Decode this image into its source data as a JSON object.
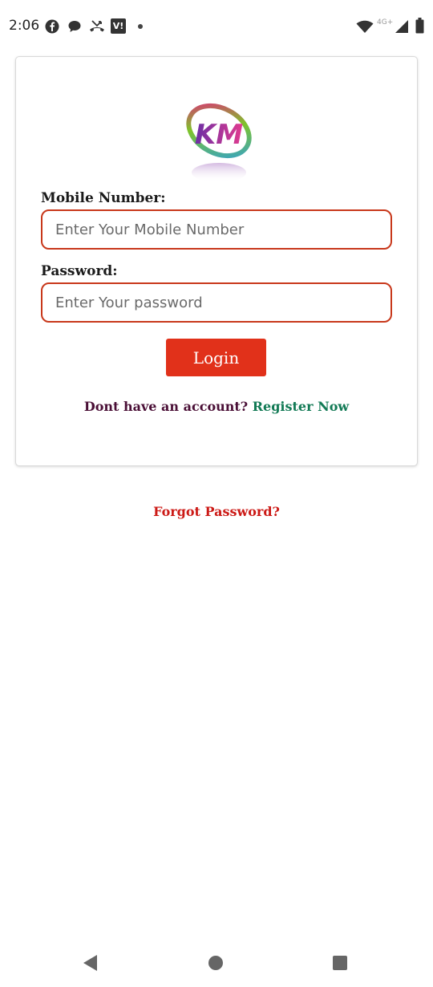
{
  "status_bar": {
    "time": "2:06",
    "network_label": "4G+",
    "left_icons": [
      "facebook-icon",
      "chat-icon",
      "missed-call-icon",
      "vi-app-icon",
      "dot-icon"
    ],
    "right_icons": [
      "wifi-icon",
      "signal-icon",
      "battery-icon"
    ]
  },
  "logo": {
    "text": "KM"
  },
  "form": {
    "mobile_label": "Mobile Number:",
    "mobile_placeholder": "Enter Your Mobile Number",
    "password_label": "Password:",
    "password_placeholder": "Enter Your password",
    "login_label": "Login"
  },
  "register": {
    "prompt": "Dont have an account?",
    "link": "Register Now"
  },
  "forgot_password": "Forgot Password?",
  "nav_bar": {
    "buttons": [
      "back-icon",
      "home-icon",
      "recents-icon"
    ]
  },
  "colors": {
    "accent": "#e1311a",
    "input_border": "#c8381b",
    "register_link": "#127a55",
    "register_prompt": "#4a0f36",
    "forgot_link": "#cc1a16"
  }
}
